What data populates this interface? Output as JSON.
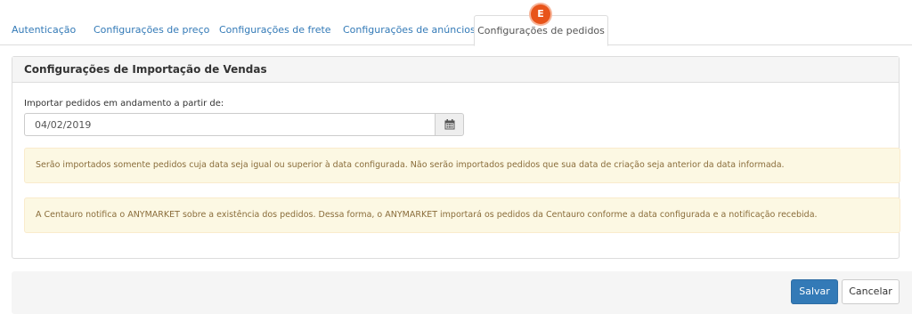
{
  "tabs": [
    {
      "label": "Autenticação"
    },
    {
      "label": "Configurações de preço"
    },
    {
      "label": "Configurações de frete"
    },
    {
      "label": "Configurações de anúncios"
    },
    {
      "label": "Configurações de pedidos",
      "active": true
    }
  ],
  "step_badge": "E",
  "panel": {
    "title": "Configurações de Importação de Vendas",
    "date_field": {
      "label": "Importar pedidos em andamento a partir de:",
      "value": "04/02/2019",
      "icon": "calendar-icon"
    },
    "alerts": [
      "Serão importados somente pedidos cuja data seja igual ou superior à data configurada. Não serão importados pedidos que sua data de criação seja anterior da data informada.",
      "A Centauro notifica o ANYMARKET sobre a existência dos pedidos. Dessa forma, o ANYMARKET importará os pedidos da Centauro conforme a data configurada e a notificação recebida."
    ]
  },
  "footer": {
    "save_label": "Salvar",
    "cancel_label": "Cancelar"
  },
  "colors": {
    "link": "#337ab7",
    "badge": "#e8541a",
    "alert_bg": "#fcf8e3",
    "alert_text": "#8a6d3b",
    "primary_button": "#337ab7"
  }
}
